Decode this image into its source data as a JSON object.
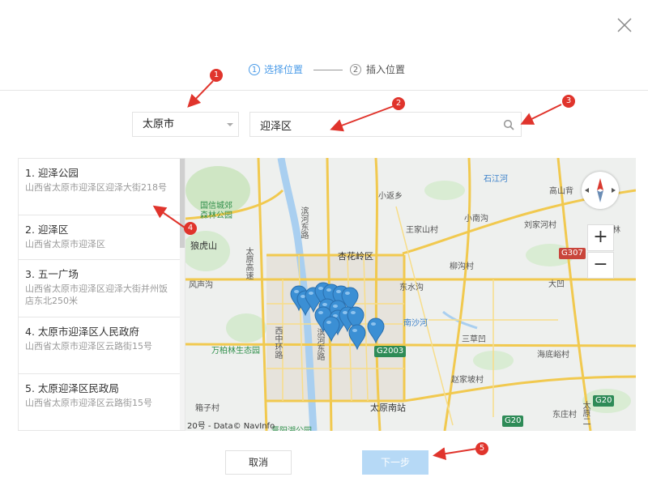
{
  "dialog": {
    "close_icon": "close-icon"
  },
  "steps": [
    {
      "number": "1",
      "label": "选择位置",
      "active": true
    },
    {
      "number": "2",
      "label": "插入位置",
      "active": false
    }
  ],
  "city_select": {
    "value": "太原市"
  },
  "search": {
    "value": "迎泽区",
    "icon": "search-icon"
  },
  "results": [
    {
      "title": "1. 迎泽公园",
      "address": "山西省太原市迎泽区迎泽大街218号"
    },
    {
      "title": "2. 迎泽区",
      "address": "山西省太原市迎泽区"
    },
    {
      "title": "3. 五一广场",
      "address": "山西省太原市迎泽区迎泽大街并州饭店东北250米"
    },
    {
      "title": "4. 太原市迎泽区人民政府",
      "address": "山西省太原市迎泽区云路街15号"
    },
    {
      "title": "5. 太原迎泽区民政局",
      "address": "山西省太原市迎泽区云路街15号"
    }
  ],
  "map": {
    "labels": {
      "shijiang": "石江河",
      "xiaofanxiang": "小返乡",
      "gaoshanbei": "高山背",
      "guochang": "国信城郊",
      "senlin": "森林公园",
      "wangjiacun": "王家山村",
      "xiaonangou": "小南沟",
      "liujiahe": "刘家河村",
      "xihanlin": "西韩林",
      "langhushan": "狼虎山",
      "xinghualing": "杏花岭区",
      "liuyucun": "柳沟村",
      "fengsheng": "风声沟",
      "dongshuigou": "东水沟",
      "dagou": "大凹",
      "nanshahe": "南沙河",
      "wanbolin": "万柏林生态园",
      "sanfenshan": "三草凹",
      "haidiwo": "海底峪村",
      "zhaojiapo": "赵家坡村",
      "taiyuan_south": "太原南站",
      "dongzhuang": "东庄村",
      "xinzicun": "箱子村",
      "jinyanghu": "晋阳湖公园",
      "binhe_east": "滨河东路",
      "binhe_east2": "滨河东路",
      "taiyuan_high": "太原高速",
      "xizhong": "西中环路",
      "taiyuan_2": "太原二"
    },
    "road_badges": {
      "g307": "G307",
      "g2003": "G2003",
      "g20a": "G20",
      "g20b": "G20"
    },
    "zoom_in": "+",
    "zoom_out": "−",
    "copyright": "20号 - Data© NavInfo",
    "marker_color": "#3b8fd4"
  },
  "buttons": {
    "cancel": "取消",
    "next": "下一步"
  },
  "annotations": [
    "1",
    "2",
    "3",
    "4",
    "5"
  ],
  "colors": {
    "accent": "#4a9be8",
    "next_button": "#b6d9f6",
    "annotation": "#e0342c"
  }
}
